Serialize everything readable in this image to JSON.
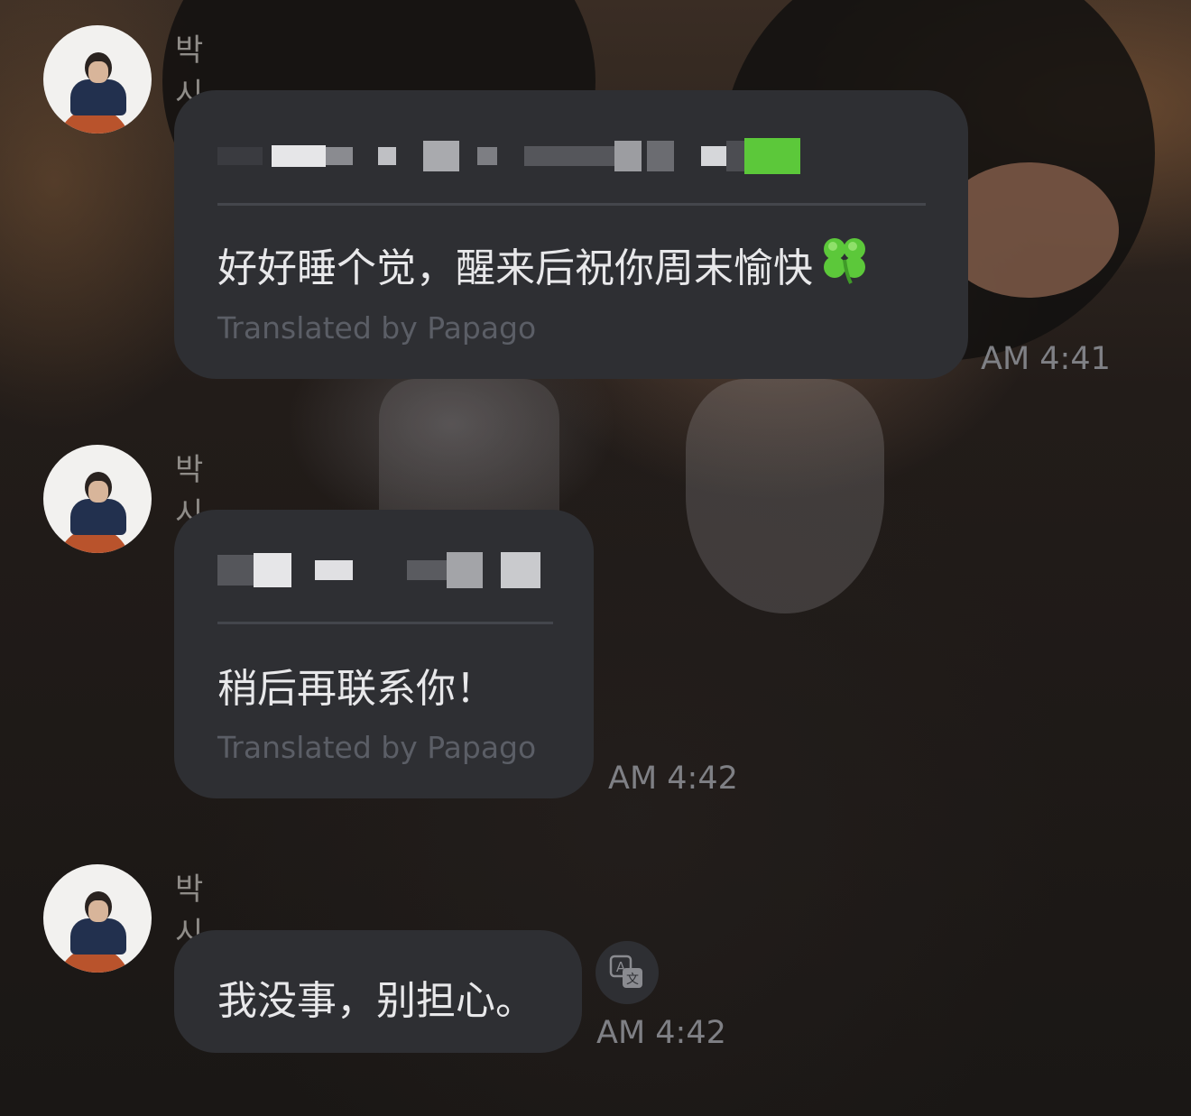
{
  "messages": [
    {
      "sender": "박시우",
      "translation": "好好睡个觉，醒来后祝你周末愉快",
      "credit": "Translated by Papago",
      "time": "AM 4:41",
      "emoji": "four-leaf-clover-icon"
    },
    {
      "sender": "박시우",
      "translation": "稍后再联系你！",
      "credit": "Translated by Papago",
      "time": "AM 4:42"
    },
    {
      "sender": "박시우",
      "translation": "我没事，别担心。",
      "time": "AM 4:42",
      "action_icon": "translate-icon"
    }
  ],
  "colors": {
    "bubble": "#2e2f33",
    "translation_text": "#e8e8ea",
    "credit_text": "#5b5e66",
    "timestamp": "#7f8085",
    "sender": "#8f8c88",
    "pixelated_original": "#d0d0d4",
    "clover_green": "#5cc83a"
  }
}
